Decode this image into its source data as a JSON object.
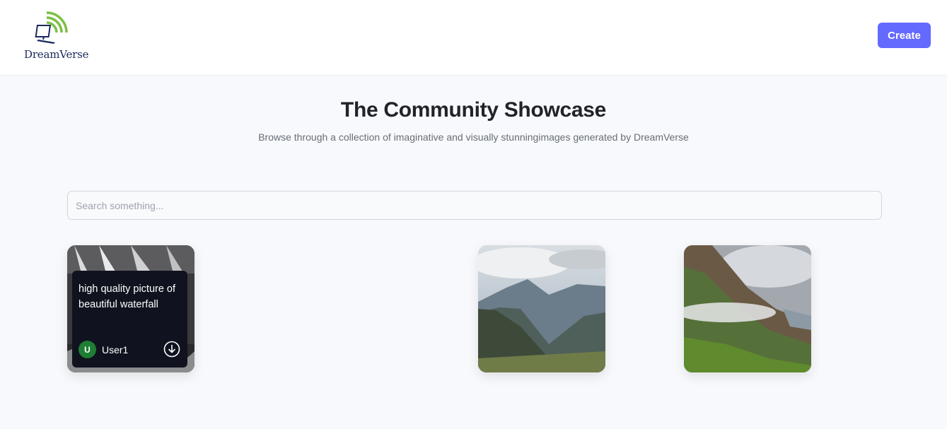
{
  "header": {
    "logo_text": "DreamVerse",
    "create_label": "Create"
  },
  "hero": {
    "title": "The Community Showcase",
    "subtitle": "Browse through a collection of imaginative and visually stunningimages generated by DreamVerse"
  },
  "search": {
    "placeholder": "Search something...",
    "value": ""
  },
  "cards": [
    {
      "prompt": "high quality picture of beautiful waterfall",
      "user": "User1",
      "avatar_initial": "U",
      "avatar_color": "#1e7e34",
      "icon": "download-icon"
    },
    {
      "image": "mountain-landscape"
    },
    {
      "image": "misty-mountain-valley"
    }
  ],
  "colors": {
    "accent": "#6469ff",
    "background": "#f8f9fc",
    "overlay": "#10131f"
  }
}
